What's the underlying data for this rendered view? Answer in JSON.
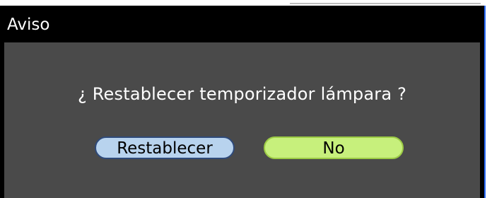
{
  "dialog": {
    "title": "Aviso",
    "message": "¿ Restablecer temporizador lámpara ?",
    "buttons": {
      "reset_label": "Restablecer",
      "no_label": "No"
    }
  },
  "colors": {
    "title_bar": "#000000",
    "body": "#4a4a4a",
    "reset_button": "#b8d3ee",
    "no_button": "#c7f07c",
    "text": "#ffffff"
  }
}
